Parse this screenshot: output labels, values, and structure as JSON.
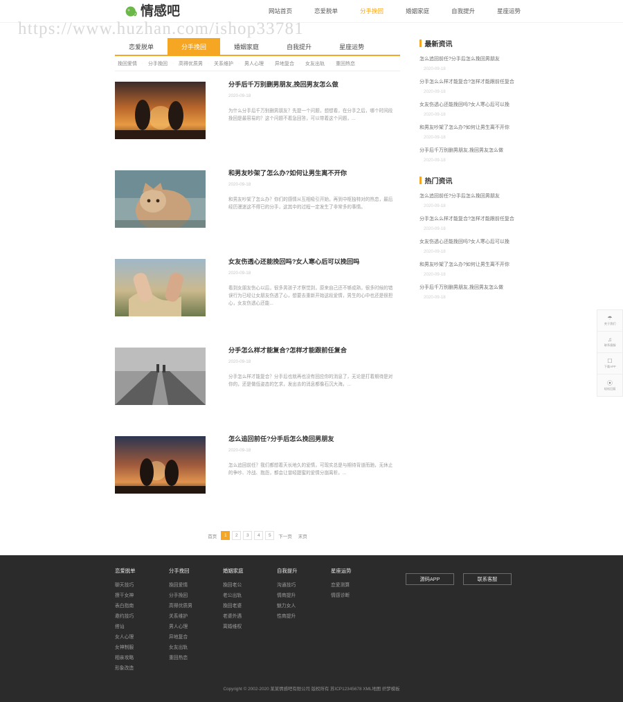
{
  "site": {
    "logo_text": "情感吧",
    "logo_icon": "elephant-icon",
    "watermark": "https://www.huzhan.com/ishop33781",
    "accent": "#f5a623",
    "footer_bg": "#2b2b2b"
  },
  "nav": {
    "items": [
      {
        "label": "网站首页",
        "active": false
      },
      {
        "label": "恋爱脱单",
        "active": false
      },
      {
        "label": "分手挽回",
        "active": true
      },
      {
        "label": "婚姻家庭",
        "active": false
      },
      {
        "label": "自我提升",
        "active": false
      },
      {
        "label": "星座运势",
        "active": false
      }
    ]
  },
  "tabs": [
    {
      "label": "恋爱脱单",
      "active": false
    },
    {
      "label": "分手挽回",
      "active": true
    },
    {
      "label": "婚姻家庭",
      "active": false
    },
    {
      "label": "自我提升",
      "active": false
    },
    {
      "label": "星座运势",
      "active": false
    }
  ],
  "subtags": [
    "挽回爱情",
    "分手挽回",
    "高得优质男",
    "关系维护",
    "男人心理",
    "异地复合",
    "女友出轨",
    "重回热恋"
  ],
  "articles": [
    {
      "title": "分手后千万别删男朋友,挽回男友怎么做",
      "date": "2020-09-18",
      "desc": "为什么分手后千万别删男朋友？先提一个问题，想想看，在分手之后，哪个时间段挽回是最容易的？这个问题不着急回答，可以带着这个问题，...",
      "thumb": "sunset-couple-silhouette"
    },
    {
      "title": "和男友吵架了怎么办?如何让男生离不开你",
      "date": "2020-09-18",
      "desc": "和男友吵架了怎么办？你们的感情从互相吸引开始，再到中枢独特对的热恋，最后经历漫迷这不得已的分手，这其中的过程一定发生了非常多的事情。",
      "thumb": "cat-pet-closeup"
    },
    {
      "title": "女友伤透心还能挽回吗?女人寒心后可以挽回吗",
      "date": "2020-09-18",
      "desc": "看到女朋友伤心以后，很多男孩子才察觉到，原来自己还不够成熟，很多时候的错误行为已经让女朋友伤透了心，想要去重新开始这段爱情，男生的心中也还是很担心，女友伤透心还能...",
      "thumb": "holding-hands-field"
    },
    {
      "title": "分手怎么样才能复合?怎样才能跟前任复合",
      "date": "2020-09-18",
      "desc": "分手怎么样才能复合？分手后也就再也没有回应你的消息了，无论是打着期待是对你的，还是做低姿态的乞求，发出去的消息都像石沉大海。...",
      "thumb": "road-grayscale"
    },
    {
      "title": "怎么追回前任?分手后怎么挽回男朋友",
      "date": "2020-09-18",
      "desc": "怎么追回前任？我们都想着天长地久的爱情，可现实总是与期待背道而驰，无休止的争吵、冷战、抱怨，都会让曾经甜蜜的爱情分崩离析。...",
      "thumb": "dusk-couple-silhouette"
    }
  ],
  "pagination": {
    "prev_label": "首页",
    "pages": [
      "1",
      "2",
      "3",
      "4",
      "5"
    ],
    "active_page": "1",
    "next_label": "下一页",
    "last_label": "末页"
  },
  "sidebar": {
    "latest": {
      "title": "最新资讯",
      "items": [
        {
          "title": "怎么追回前任?分手后怎么挽回男朋友",
          "date": "2020-09-18"
        },
        {
          "title": "分手怎么么样才能复合?怎样才能跟前任复合",
          "date": "2020-09-18"
        },
        {
          "title": "女友伤透心还能挽回吗?女人寒心后可以挽",
          "date": "2020-09-18"
        },
        {
          "title": "和男友吵架了怎么办?如何让男生离不开你",
          "date": "2020-09-18"
        },
        {
          "title": "分手后千万别删男朋友,挽回男友怎么做",
          "date": "2020-09-18"
        }
      ]
    },
    "hot": {
      "title": "热门资讯",
      "items": [
        {
          "title": "怎么追回前任?分手后怎么挽回男朋友",
          "date": "2020-09-18"
        },
        {
          "title": "分手怎么么样才能复合?怎样才能跟前任复合",
          "date": "2020-09-18"
        },
        {
          "title": "女友伤透心还能挽回吗?女人寒心后可以挽",
          "date": "2020-09-18"
        },
        {
          "title": "和男友吵架了怎么办?如何让男生离不开你",
          "date": "2020-09-18"
        },
        {
          "title": "分手后千万别删男朋友,挽回男友怎么做",
          "date": "2020-09-18"
        }
      ]
    }
  },
  "floater": {
    "items": [
      {
        "icon": "about-icon",
        "label": "关于我们"
      },
      {
        "icon": "headset-icon",
        "label": "联系客服"
      },
      {
        "icon": "phone-icon",
        "label": "下载APP"
      },
      {
        "icon": "reply-icon",
        "label": "轻松回复"
      }
    ]
  },
  "footer": {
    "columns": [
      {
        "title": "恋爱脱单",
        "links": [
          "聊天技巧",
          "撩干女神",
          "表白指南",
          "邀约技巧",
          "搭讪",
          "女人心理",
          "女神制服",
          "相亲攻略",
          "形象改造"
        ]
      },
      {
        "title": "分手挽回",
        "links": [
          "挽回爱情",
          "分手挽回",
          "高得优质男",
          "关系维护",
          "男人心理",
          "异地复合",
          "女友出轨",
          "重回热恋"
        ]
      },
      {
        "title": "婚姻家庭",
        "links": [
          "挽回老公",
          "老公出轨",
          "挽回老婆",
          "老婆外遇",
          "离婚维权"
        ]
      },
      {
        "title": "自我提升",
        "links": [
          "沟通技巧",
          "情商提升",
          "魅力女人",
          "性商提升"
        ]
      },
      {
        "title": "星座运势",
        "links": [
          "恋爱测算",
          "情感诊断"
        ]
      }
    ],
    "buttons": [
      {
        "label": "源码APP"
      },
      {
        "label": "联系客服"
      }
    ],
    "copyright": "Copyright © 2002-2020 某某情感吧有限公司 版权所有 苏ICP12345678 XML地图 织梦模板"
  }
}
